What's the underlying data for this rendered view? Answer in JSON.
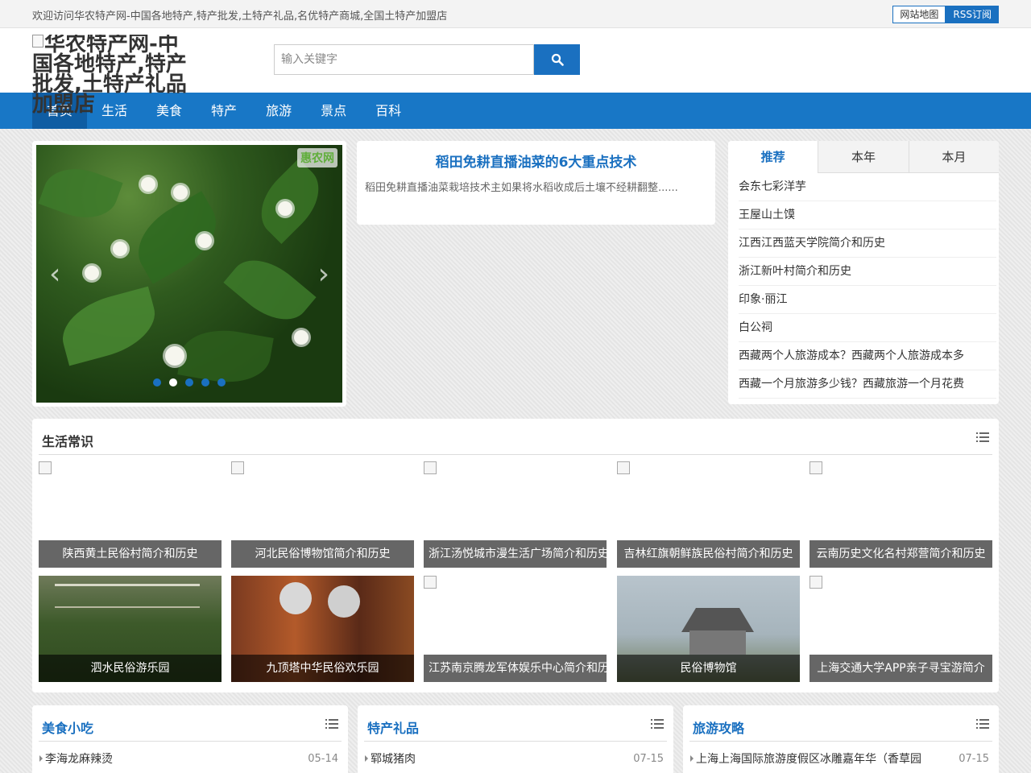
{
  "topbar": {
    "welcome": "欢迎访问华农特产网-中国各地特产,特产批发,土特产礼品,名优特产商城,全国土特产加盟店",
    "sitemap": "网站地图",
    "rss": "RSS订阅"
  },
  "header": {
    "logo_alt": "华农特产网-中国各地特产,特产批发,土特产礼品加盟店"
  },
  "search": {
    "placeholder": "输入关键字",
    "icon": "search-icon"
  },
  "nav": [
    "首页",
    "生活",
    "美食",
    "特产",
    "旅游",
    "景点",
    "百科"
  ],
  "headline": {
    "title": "稻田免耕直播油菜的6大重点技术",
    "summary": "稻田免耕直播油菜栽培技术主如果将水稻收成后土壤不经耕翻整......"
  },
  "tabs": {
    "labels": [
      "推荐",
      "本年",
      "本月"
    ],
    "items": [
      "会东七彩洋芋",
      "王屋山土馍",
      "江西江西蓝天学院简介和历史",
      "浙江新叶村简介和历史",
      "印象·丽江",
      "白公祠",
      "西藏两个人旅游成本？西藏两个人旅游成本多",
      "西藏一个月旅游多少钱？西藏旅游一个月花费"
    ]
  },
  "life": {
    "title": "生活常识",
    "cards": [
      "陕西黄土民俗村简介和历史",
      "河北民俗博物馆简介和历史",
      "浙江汤悦城市漫生活广场简介和历史",
      "吉林红旗朝鲜族民俗村简介和历史",
      "云南历史文化名村郑营简介和历史",
      "泗水民俗游乐园",
      "九顶塔中华民俗欢乐园",
      "江苏南京腾龙军体娱乐中心简介和历史",
      "民俗博物馆",
      "上海交通大学APP亲子寻宝游简介"
    ]
  },
  "food": {
    "title": "美食小吃",
    "item": "李海龙麻辣烫",
    "date": "05-14"
  },
  "gift": {
    "title": "特产礼品",
    "item": "郓城猪肉",
    "date": "07-15"
  },
  "travel": {
    "title": "旅游攻略",
    "item": "上海上海国际旅游度假区冰雕嘉年华（香草园",
    "date": "07-15"
  },
  "colors": {
    "primary": "#1877c6",
    "nav_active": "#0f5da3"
  }
}
